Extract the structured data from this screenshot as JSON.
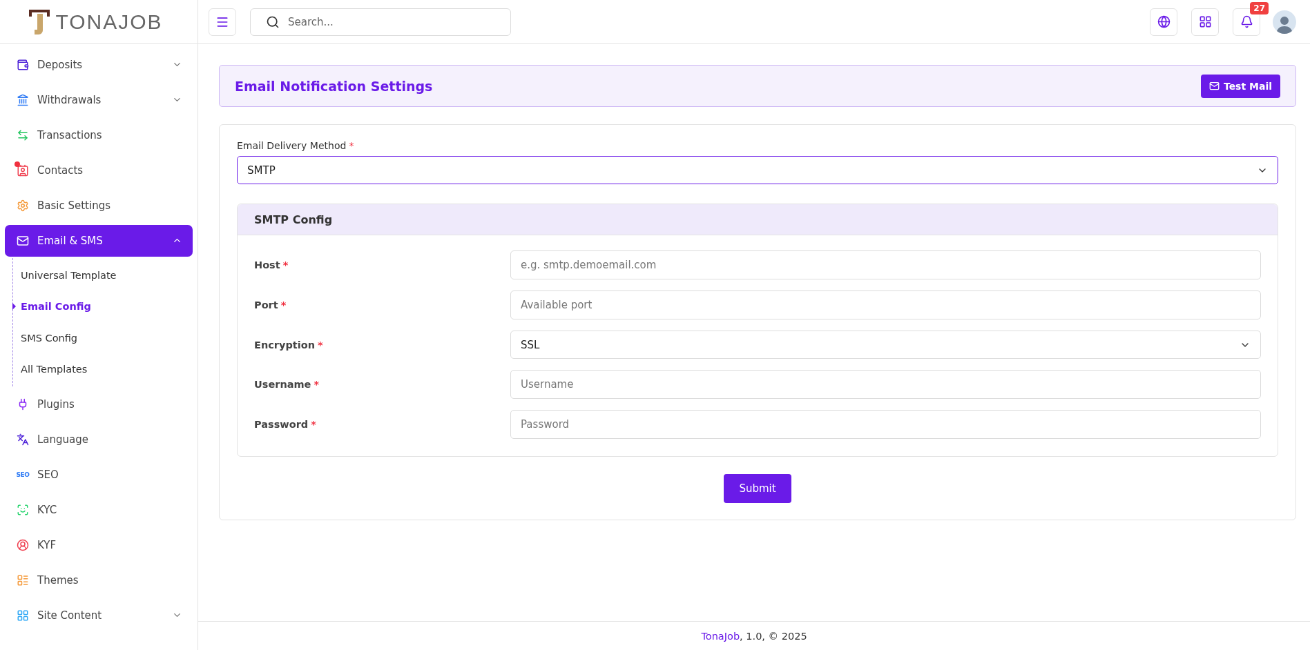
{
  "logo": {
    "text": "TONAJOB"
  },
  "sidebar": {
    "items": [
      {
        "label": "Deposits",
        "expanded": false,
        "selected": false,
        "alert": false
      },
      {
        "label": "Withdrawals",
        "expanded": false,
        "selected": false,
        "alert": false
      },
      {
        "label": "Transactions",
        "selected": false,
        "alert": false
      },
      {
        "label": "Contacts",
        "selected": false,
        "alert": true
      },
      {
        "label": "Basic Settings",
        "selected": false,
        "alert": false
      },
      {
        "label": "Email & SMS",
        "expanded": true,
        "selected": true,
        "alert": false,
        "children": [
          {
            "label": "Universal Template",
            "selected": false
          },
          {
            "label": "Email Config",
            "selected": true
          },
          {
            "label": "SMS Config",
            "selected": false
          },
          {
            "label": "All Templates",
            "selected": false
          }
        ]
      },
      {
        "label": "Plugins",
        "selected": false,
        "alert": false
      },
      {
        "label": "Language",
        "selected": false,
        "alert": false
      },
      {
        "label": "SEO",
        "icon_text": "SEO",
        "selected": false,
        "alert": false
      },
      {
        "label": "KYC",
        "selected": false,
        "alert": false
      },
      {
        "label": "KYF",
        "selected": false,
        "alert": false
      },
      {
        "label": "Themes",
        "selected": false,
        "alert": false
      },
      {
        "label": "Site Content",
        "expanded": false,
        "selected": false,
        "alert": false
      }
    ]
  },
  "header": {
    "search": {
      "placeholder": "Search..."
    },
    "notifications": {
      "count": "27"
    }
  },
  "page": {
    "title": "Email Notification Settings",
    "test_button": "Test Mail",
    "delivery": {
      "label": "Email Delivery Method",
      "required_mark": "*",
      "value": "SMTP"
    },
    "config": {
      "title": "SMTP Config",
      "fields": [
        {
          "kind": "input",
          "label": "Host",
          "required_mark": "*",
          "placeholder": "e.g. smtp.demoemail.com"
        },
        {
          "kind": "input",
          "label": "Port",
          "required_mark": "*",
          "placeholder": "Available port"
        },
        {
          "kind": "select",
          "label": "Encryption",
          "required_mark": "*",
          "value": "SSL"
        },
        {
          "kind": "input",
          "label": "Username",
          "required_mark": "*",
          "placeholder": "Username"
        },
        {
          "kind": "input",
          "label": "Password",
          "required_mark": "*",
          "placeholder": "Password"
        }
      ]
    },
    "submit": "Submit"
  },
  "footer": {
    "brand": "TonaJob",
    "text": ", 1.0, © 2025"
  }
}
